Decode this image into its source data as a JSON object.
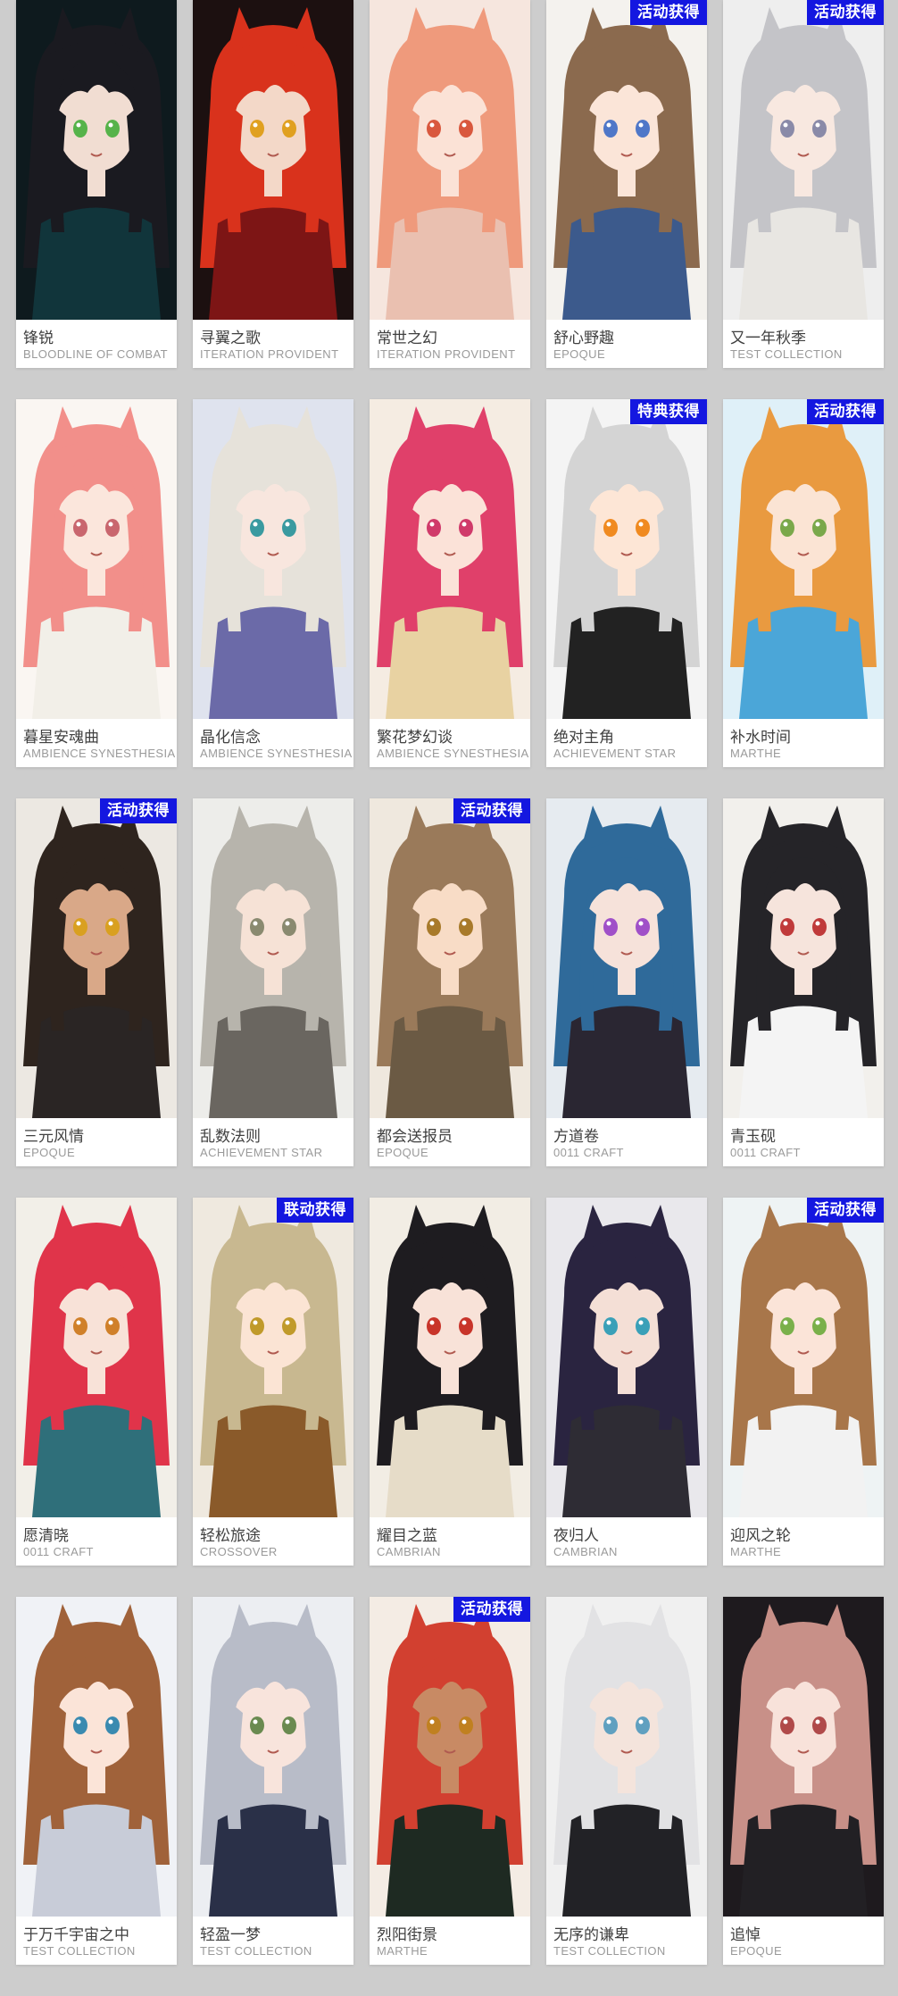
{
  "cards": [
    {
      "name": "锋锐",
      "brand": "BLOODLINE OF COMBAT",
      "badge": "",
      "hair": "#1a1a20",
      "bg": "#0e1a1e",
      "outfit": "#11353b",
      "skin": "#f1ddd2",
      "eye": "#56b34a"
    },
    {
      "name": "寻翼之歌",
      "brand": "ITERATION PROVIDENT",
      "badge": "",
      "hair": "#d9321c",
      "bg": "#1c1010",
      "outfit": "#7d1515",
      "skin": "#f3d8c8",
      "eye": "#e0a020"
    },
    {
      "name": "常世之幻",
      "brand": "ITERATION PROVIDENT",
      "badge": "",
      "hair": "#ef9a7c",
      "bg": "#f6e6de",
      "outfit": "#eac0b0",
      "skin": "#fbe2d6",
      "eye": "#d9583e"
    },
    {
      "name": "舒心野趣",
      "brand": "EPOQUE",
      "badge": "活动获得",
      "hair": "#8b6a4e",
      "bg": "#f4f2ee",
      "outfit": "#3c5a8c",
      "skin": "#fbe5d8",
      "eye": "#4f77c8"
    },
    {
      "name": "又一年秋季",
      "brand": "TEST COLLECTION",
      "badge": "活动获得",
      "hair": "#c4c4c8",
      "bg": "#eeeeee",
      "outfit": "#e8e6e2",
      "skin": "#f8e8e0",
      "eye": "#8a8aa8"
    },
    {
      "name": "暮星安魂曲",
      "brand": "AMBIENCE SYNESTHESIA",
      "badge": "",
      "hair": "#f28f8a",
      "bg": "#faf6f2",
      "outfit": "#f2efe8",
      "skin": "#fbe6dc",
      "eye": "#c9666e"
    },
    {
      "name": "晶化信念",
      "brand": "AMBIENCE SYNESTHESIA",
      "badge": "",
      "hair": "#e6e2da",
      "bg": "#dfe3ee",
      "outfit": "#6b6aa8",
      "skin": "#f8e6de",
      "eye": "#3a9aa0"
    },
    {
      "name": "繁花梦幻谈",
      "brand": "AMBIENCE SYNESTHESIA",
      "badge": "",
      "hair": "#e0406a",
      "bg": "#f5ece2",
      "outfit": "#e8d2a2",
      "skin": "#fbe2d8",
      "eye": "#d03a6a"
    },
    {
      "name": "绝对主角",
      "brand": "ACHIEVEMENT STAR",
      "badge": "特典获得",
      "hair": "#d4d4d4",
      "bg": "#f4f4f4",
      "outfit": "#222222",
      "skin": "#fde6d6",
      "eye": "#f08a20"
    },
    {
      "name": "补水时间",
      "brand": "MARTHE",
      "badge": "活动获得",
      "hair": "#e99a40",
      "bg": "#dff0f8",
      "outfit": "#4ba6d8",
      "skin": "#fbe4d4",
      "eye": "#7aa84a"
    },
    {
      "name": "三元风情",
      "brand": "EPOQUE",
      "badge": "活动获得",
      "hair": "#2e241e",
      "bg": "#ece8e2",
      "outfit": "#2a2524",
      "skin": "#d9a888",
      "eye": "#d9a020"
    },
    {
      "name": "乱数法则",
      "brand": "ACHIEVEMENT STAR",
      "badge": "",
      "hair": "#b7b4ac",
      "bg": "#ededea",
      "outfit": "#6a6660",
      "skin": "#f6e2d6",
      "eye": "#8a8a70"
    },
    {
      "name": "都会送报员",
      "brand": "EPOQUE",
      "badge": "活动获得",
      "hair": "#9a7a5a",
      "bg": "#efe8de",
      "outfit": "#6b5a44",
      "skin": "#f8dcc6",
      "eye": "#a87a2a"
    },
    {
      "name": "方道卷",
      "brand": "0011 CRAFT",
      "badge": "",
      "hair": "#2f6a9a",
      "bg": "#e6ebf0",
      "outfit": "#2a2632",
      "skin": "#f6e2da",
      "eye": "#a050c8"
    },
    {
      "name": "青玉砚",
      "brand": "0011 CRAFT",
      "badge": "",
      "hair": "#252428",
      "bg": "#f2f0ec",
      "outfit": "#f4f4f4",
      "skin": "#f6e4dc",
      "eye": "#c03a3a"
    },
    {
      "name": "愿清晓",
      "brand": "0011 CRAFT",
      "badge": "",
      "hair": "#e0344a",
      "bg": "#f2efe8",
      "outfit": "#2f6f7a",
      "skin": "#f8e2d8",
      "eye": "#d0802a"
    },
    {
      "name": "轻松旅途",
      "brand": "CROSSOVER",
      "badge": "联动获得",
      "hair": "#c8b890",
      "bg": "#efe9df",
      "outfit": "#8a5a2a",
      "skin": "#fbe4d4",
      "eye": "#c09a2a"
    },
    {
      "name": "耀目之蓝",
      "brand": "CAMBRIAN",
      "badge": "",
      "hair": "#1e1c20",
      "bg": "#f2ede4",
      "outfit": "#e6dcc8",
      "skin": "#f8e2d8",
      "eye": "#c8342a"
    },
    {
      "name": "夜归人",
      "brand": "CAMBRIAN",
      "badge": "",
      "hair": "#2a2440",
      "bg": "#e9e8ec",
      "outfit": "#2e2c34",
      "skin": "#f4dfd6",
      "eye": "#3aa0b8"
    },
    {
      "name": "迎风之轮",
      "brand": "MARTHE",
      "badge": "活动获得",
      "hair": "#a8764a",
      "bg": "#eef3f4",
      "outfit": "#f2f2f2",
      "skin": "#fbe4d8",
      "eye": "#7ab04a"
    },
    {
      "name": "于万千宇宙之中",
      "brand": "TEST COLLECTION",
      "badge": "",
      "hair": "#a0623a",
      "bg": "#f0f2f6",
      "outfit": "#c8ccd8",
      "skin": "#fbe4d8",
      "eye": "#3a8ab0"
    },
    {
      "name": "轻盈一梦",
      "brand": "TEST COLLECTION",
      "badge": "",
      "hair": "#b8bcc8",
      "bg": "#eceef2",
      "outfit": "#2a3048",
      "skin": "#f8e4dc",
      "eye": "#6a8a50"
    },
    {
      "name": "烈阳街景",
      "brand": "MARTHE",
      "badge": "活动获得",
      "hair": "#d24030",
      "bg": "#f4ece4",
      "outfit": "#1e2a22",
      "skin": "#c88a64",
      "eye": "#c08020"
    },
    {
      "name": "无序的谦卑",
      "brand": "TEST COLLECTION",
      "badge": "",
      "hair": "#e2e2e4",
      "bg": "#f0f0f0",
      "outfit": "#222226",
      "skin": "#f4e4dc",
      "eye": "#60a0c0"
    },
    {
      "name": "追悼",
      "brand": "EPOQUE",
      "badge": "",
      "hair": "#c89088",
      "bg": "#1e1a1e",
      "outfit": "#222024",
      "skin": "#f8e2da",
      "eye": "#b04a4a"
    }
  ]
}
